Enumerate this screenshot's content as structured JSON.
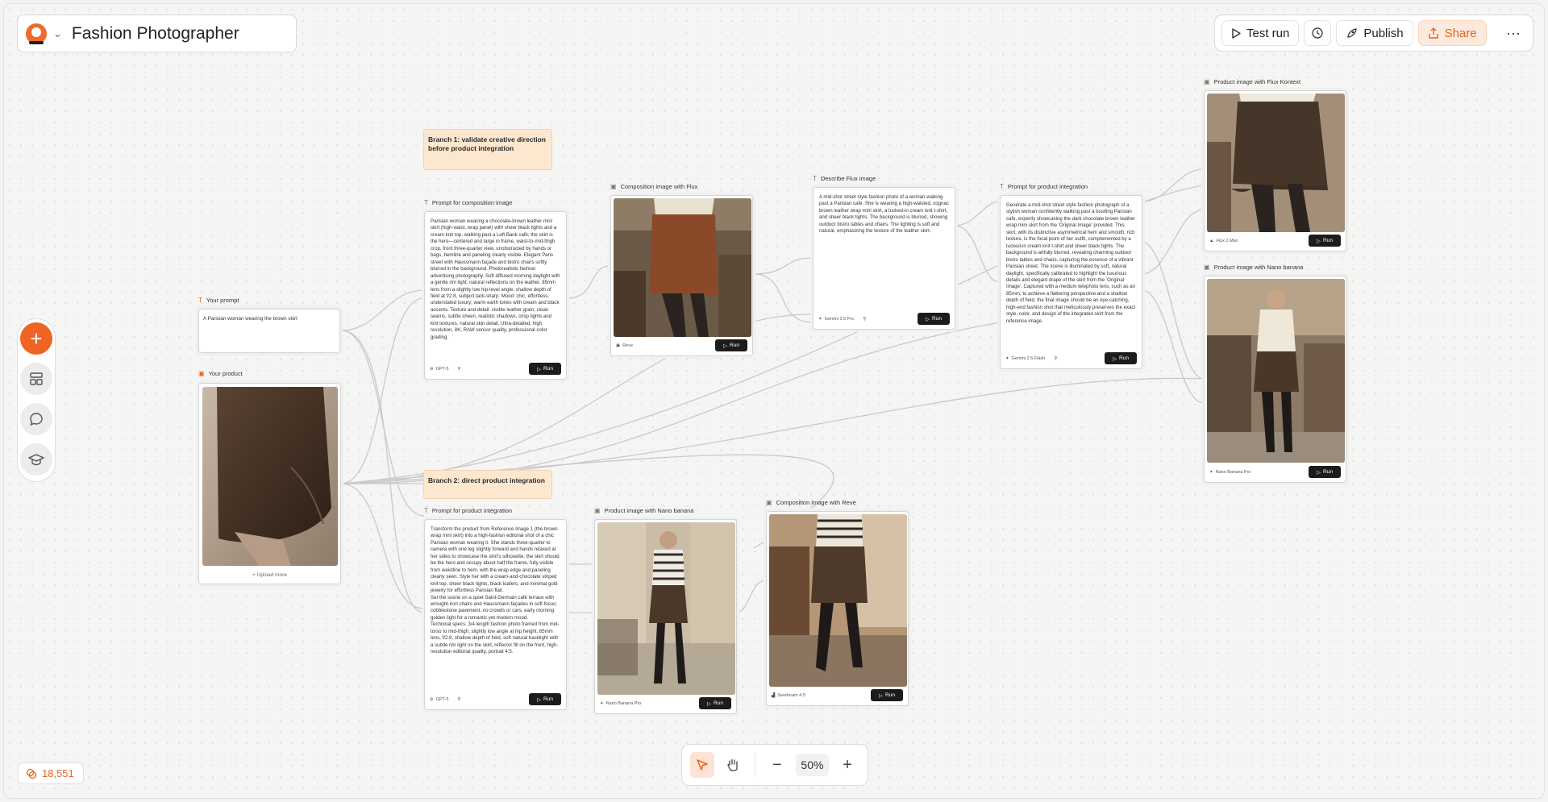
{
  "app": {
    "title": "Fashion Photographer",
    "accent": "#f06423"
  },
  "toolbar": {
    "test_run": "Test run",
    "publish": "Publish",
    "share": "Share"
  },
  "credits": "18,551",
  "zoom": "50%",
  "sticky_notes": [
    "Branch 1: validate creative direction before product integration",
    "Branch 2: direct product integration"
  ],
  "nodes": {
    "your_prompt": {
      "label": "Your prompt",
      "value": "A Parisian woman wearing the brown skirt"
    },
    "your_product": {
      "label": "Your product",
      "upload": "Upload more"
    },
    "prompt_composition": {
      "label": "Prompt for composition image",
      "text": "Parisian woman wearing a chocolate-brown leather mini skirt (high-waist, wrap panel) with sheer black tights and a cream knit top, walking past a Left Bank café; the skirt is the hero—centered and large in frame, waist-to-mid-thigh crop, front three-quarter view, unobstructed by hands or bags, hemline and paneling clearly visible. Elegant Paris street with Haussmann façade and bistro chairs softly blurred in the background. Photorealistic fashion advertising photography. Soft diffused morning daylight with a gentle rim light; natural reflections on the leather. 85mm lens from a slightly low hip-level angle, shallow depth of field at f/2.8, subject tack-sharp. Mood: chic, effortless, understated luxury; warm earth tones with cream and black accents. Texture and detail: visible leather grain, clean seams, subtle sheen, realistic shadows, crisp tights and knit textures, natural skin detail. Ultra-detailed, high resolution, 8K, RAW sensor quality, professional color grading.",
      "model": "GPT-5",
      "run": "Run"
    },
    "composition_flux": {
      "label": "Composition image with Flux",
      "model": "Reve",
      "run": "Run"
    },
    "describe_flux": {
      "label": "Describe Flux image",
      "text": "A mid-shot street style fashion photo of a woman walking past a Parisian cafe. She is wearing a high-waisted, cognac brown leather wrap mini skirt, a tucked-in cream knit t-shirt, and sheer black tights. The background is blurred, showing outdoor bistro tables and chairs. The lighting is soft and natural, emphasizing the texture of the leather skirt.",
      "model": "Gemini 2.5 Pro",
      "run": "Run"
    },
    "prompt_product": {
      "label": "Prompt for product integration",
      "text": "Generate a mid-shot street style fashion photograph of a stylish woman confidently walking past a bustling Parisian cafe, expertly showcasing the dark chocolate brown leather wrap mini skirt from the 'Original Image' provided. This skirt, with its distinctive asymmetrical hem and smooth, rich texture, is the focal point of her outfit, complemented by a tucked-in cream knit t-shirt and sheer black tights. The background is artfully blurred, revealing charming outdoor bistro tables and chairs, capturing the essence of a vibrant Parisian street. The scene is illuminated by soft, natural daylight, specifically calibrated to highlight the luxurious details and elegant drape of the skirt from the 'Original Image'. Captured with a medium telephoto lens, such as an 85mm, to achieve a flattering perspective and a shallow depth of field, the final image should be an eye-catching, high-end fashion shot that meticulously preserves the exact style, color, and design of the integrated skirt from the reference image.",
      "model": "Gemini 2.5 Flash",
      "run": "Run"
    },
    "product_flux_kontext": {
      "label": "Product image with Flux Kontext",
      "model": "Flux 2 Max",
      "run": "Run"
    },
    "product_nano_top": {
      "label": "Product image with Nano banana",
      "model": "Nano Banana Pro",
      "run": "Run"
    },
    "prompt_product_b2": {
      "label": "Prompt for product integration",
      "text": "Transform the product from Reference Image 1 (the brown wrap mini skirt) into a high-fashion editorial shot of a chic Parisian woman wearing it. She stands three-quarter to camera with one leg slightly forward and hands relaxed at her sides to showcase the skirt's silhouette; the skirt should be the hero and occupy about half the frame, fully visible from waistline to hem, with the wrap edge and paneling clearly seen. Style her with a cream-and-chocolate striped knit top, sheer black tights, black loafers, and minimal gold jewelry for effortless Parisian flair.\nSet the scene on a quiet Saint-Germain café terrace with wrought-iron chairs and Haussmann façades in soft focus; cobblestone pavement, no crowds or cars, early morning golden light for a romantic yet modern mood.\nTechnical specs: 3/4 length fashion photo framed from mid-torso to mid-thigh, slightly low angle at hip height, 85mm lens, f/2.8, shallow depth of field, soft natural backlight with a subtle rim light on the skirt, reflector fill on the front, high-resolution editorial quality, portrait 4:5.",
      "model": "GPT-5",
      "run": "Run"
    },
    "product_nano_b2": {
      "label": "Product image with Nano banana",
      "model": "Nano Banana Pro",
      "run": "Run"
    },
    "composition_reve": {
      "label": "Composition image with Reve",
      "model": "Seedream 4.5",
      "run": "Run"
    }
  }
}
